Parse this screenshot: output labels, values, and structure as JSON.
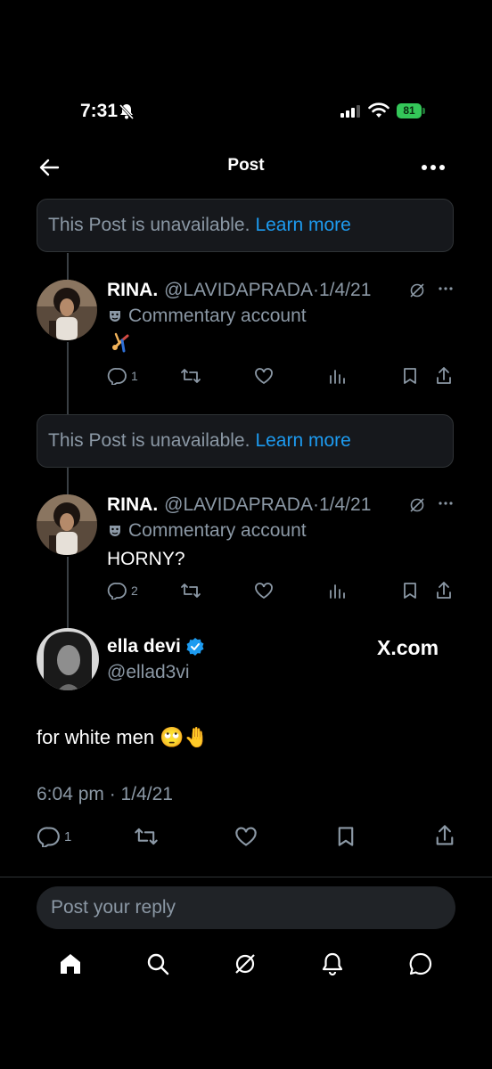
{
  "status_bar": {
    "time": "7:31",
    "battery": "81"
  },
  "header": {
    "title": "Post"
  },
  "unavailable_1": {
    "text": "This Post is unavailable.",
    "link": "Learn more"
  },
  "reply_1": {
    "name": "RINA.",
    "handle": "@LAVIDAPRADA",
    "date": "1/4/21",
    "label": "Commentary account",
    "reply_count": "1"
  },
  "unavailable_2": {
    "text": "This Post is unavailable.",
    "link": "Learn more"
  },
  "reply_2": {
    "name": "RINA.",
    "handle": "@LAVIDAPRADA",
    "date": "1/4/21",
    "label": "Commentary account",
    "text": "HORNY?",
    "reply_count": "2"
  },
  "main_post": {
    "name": "ella devi",
    "handle": "@ellad3vi",
    "watermark": "X.com",
    "text": "for white men 🙄🤚",
    "timestamp": "6:04 pm · 1/4/21",
    "reply_count": "1"
  },
  "composer": {
    "placeholder": "Post your reply"
  },
  "colors": {
    "link": "#1d9bf0",
    "verified": "#1d9bf0",
    "battery": "#34c759"
  }
}
